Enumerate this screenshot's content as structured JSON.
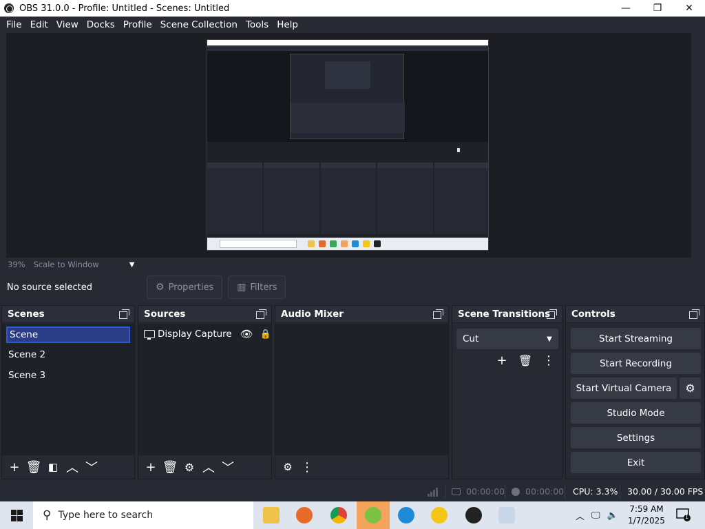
{
  "window": {
    "title": "OBS 31.0.0 - Profile: Untitled - Scenes: Untitled",
    "minimize": "—",
    "maximize": "❐",
    "close": "✕"
  },
  "menu": [
    "File",
    "Edit",
    "View",
    "Docks",
    "Profile",
    "Scene Collection",
    "Tools",
    "Help"
  ],
  "preview": {
    "zoom": "39%",
    "scale_mode": "Scale to Window"
  },
  "context": {
    "no_source": "No source selected",
    "properties": "Properties",
    "filters": "Filters"
  },
  "docks": {
    "scenes": {
      "title": "Scenes",
      "items": [
        "Scene",
        "Scene 2",
        "Scene 3"
      ],
      "selected": 0
    },
    "sources": {
      "title": "Sources",
      "items": [
        {
          "name": "Display Capture",
          "icon": "monitor-icon"
        }
      ]
    },
    "audio_mixer": {
      "title": "Audio Mixer"
    },
    "scene_transitions": {
      "title": "Scene Transitions",
      "transition": "Cut"
    },
    "controls": {
      "title": "Controls",
      "start_streaming": "Start Streaming",
      "start_recording": "Start Recording",
      "start_virtual_camera": "Start Virtual Camera",
      "studio_mode": "Studio Mode",
      "settings": "Settings",
      "exit": "Exit"
    }
  },
  "status": {
    "stream_time": "00:00:00",
    "record_time": "00:00:00",
    "cpu": "CPU: 3.3%",
    "fps": "30.00 / 30.00 FPS"
  },
  "taskbar": {
    "search_placeholder": "Type here to search",
    "time": "7:59 AM",
    "date": "1/7/2025",
    "notification_count": "1",
    "apps": [
      {
        "name": "file-explorer-icon",
        "color": "#f0c24a"
      },
      {
        "name": "firefox-icon",
        "color": "#e86a2b"
      },
      {
        "name": "chrome-icon",
        "color": "#3aa757"
      },
      {
        "name": "app-icon-green",
        "color": "#7cc242"
      },
      {
        "name": "edge-icon",
        "color": "#1f8ad8"
      },
      {
        "name": "app-icon-yellow",
        "color": "#f5c518"
      },
      {
        "name": "obs-icon",
        "color": "#222222"
      },
      {
        "name": "app-icon-cloud",
        "color": "#c9d6e8"
      }
    ]
  },
  "colors": {
    "background": "#272a33",
    "panel": "#1f2128",
    "button": "#363a45",
    "selection": "#2a3d86",
    "taskbar": "#dfe5ee"
  }
}
